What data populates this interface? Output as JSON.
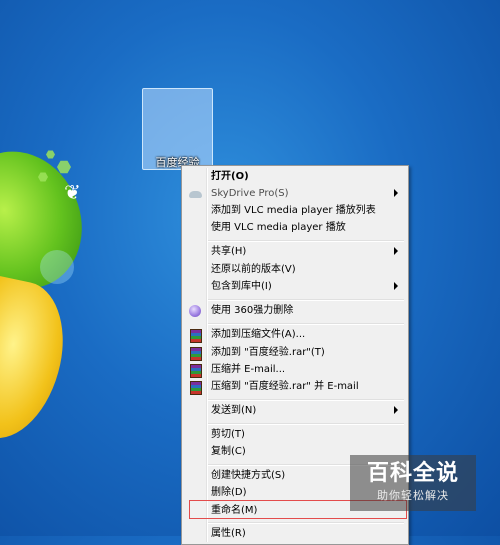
{
  "desktop": {
    "icon_label": "百度经验"
  },
  "context_menu": {
    "items": [
      {
        "label": "打开(O)",
        "bold": true
      },
      {
        "label": "SkyDrive Pro(S)",
        "icon": "cloud-icon",
        "submenu": true,
        "dim": true
      },
      {
        "label": "添加到 VLC media player 播放列表"
      },
      {
        "label": "使用 VLC media player 播放"
      },
      {
        "label": "共享(H)",
        "submenu": true
      },
      {
        "label": "还原以前的版本(V)"
      },
      {
        "label": "包含到库中(I)",
        "submenu": true
      },
      {
        "label": "使用 360强力删除",
        "icon": "360-icon"
      },
      {
        "label": "添加到压缩文件(A)...",
        "icon": "winrar-icon"
      },
      {
        "label": "添加到 \"百度经验.rar\"(T)",
        "icon": "winrar-icon"
      },
      {
        "label": "压缩并 E-mail...",
        "icon": "winrar-icon"
      },
      {
        "label": "压缩到 \"百度经验.rar\" 并 E-mail",
        "icon": "winrar-icon"
      },
      {
        "label": "发送到(N)",
        "submenu": true
      },
      {
        "label": "剪切(T)"
      },
      {
        "label": "复制(C)"
      },
      {
        "label": "创建快捷方式(S)"
      },
      {
        "label": "删除(D)"
      },
      {
        "label": "重命名(M)",
        "highlighted": true
      },
      {
        "label": "属性(R)"
      }
    ]
  },
  "watermark": {
    "title": "百科全说",
    "subtitle": "助你轻松解决"
  },
  "colors": {
    "desktop_blue": "#1a6cc4",
    "menu_bg": "#f0f0f0",
    "highlight_border": "#e34b4b"
  }
}
